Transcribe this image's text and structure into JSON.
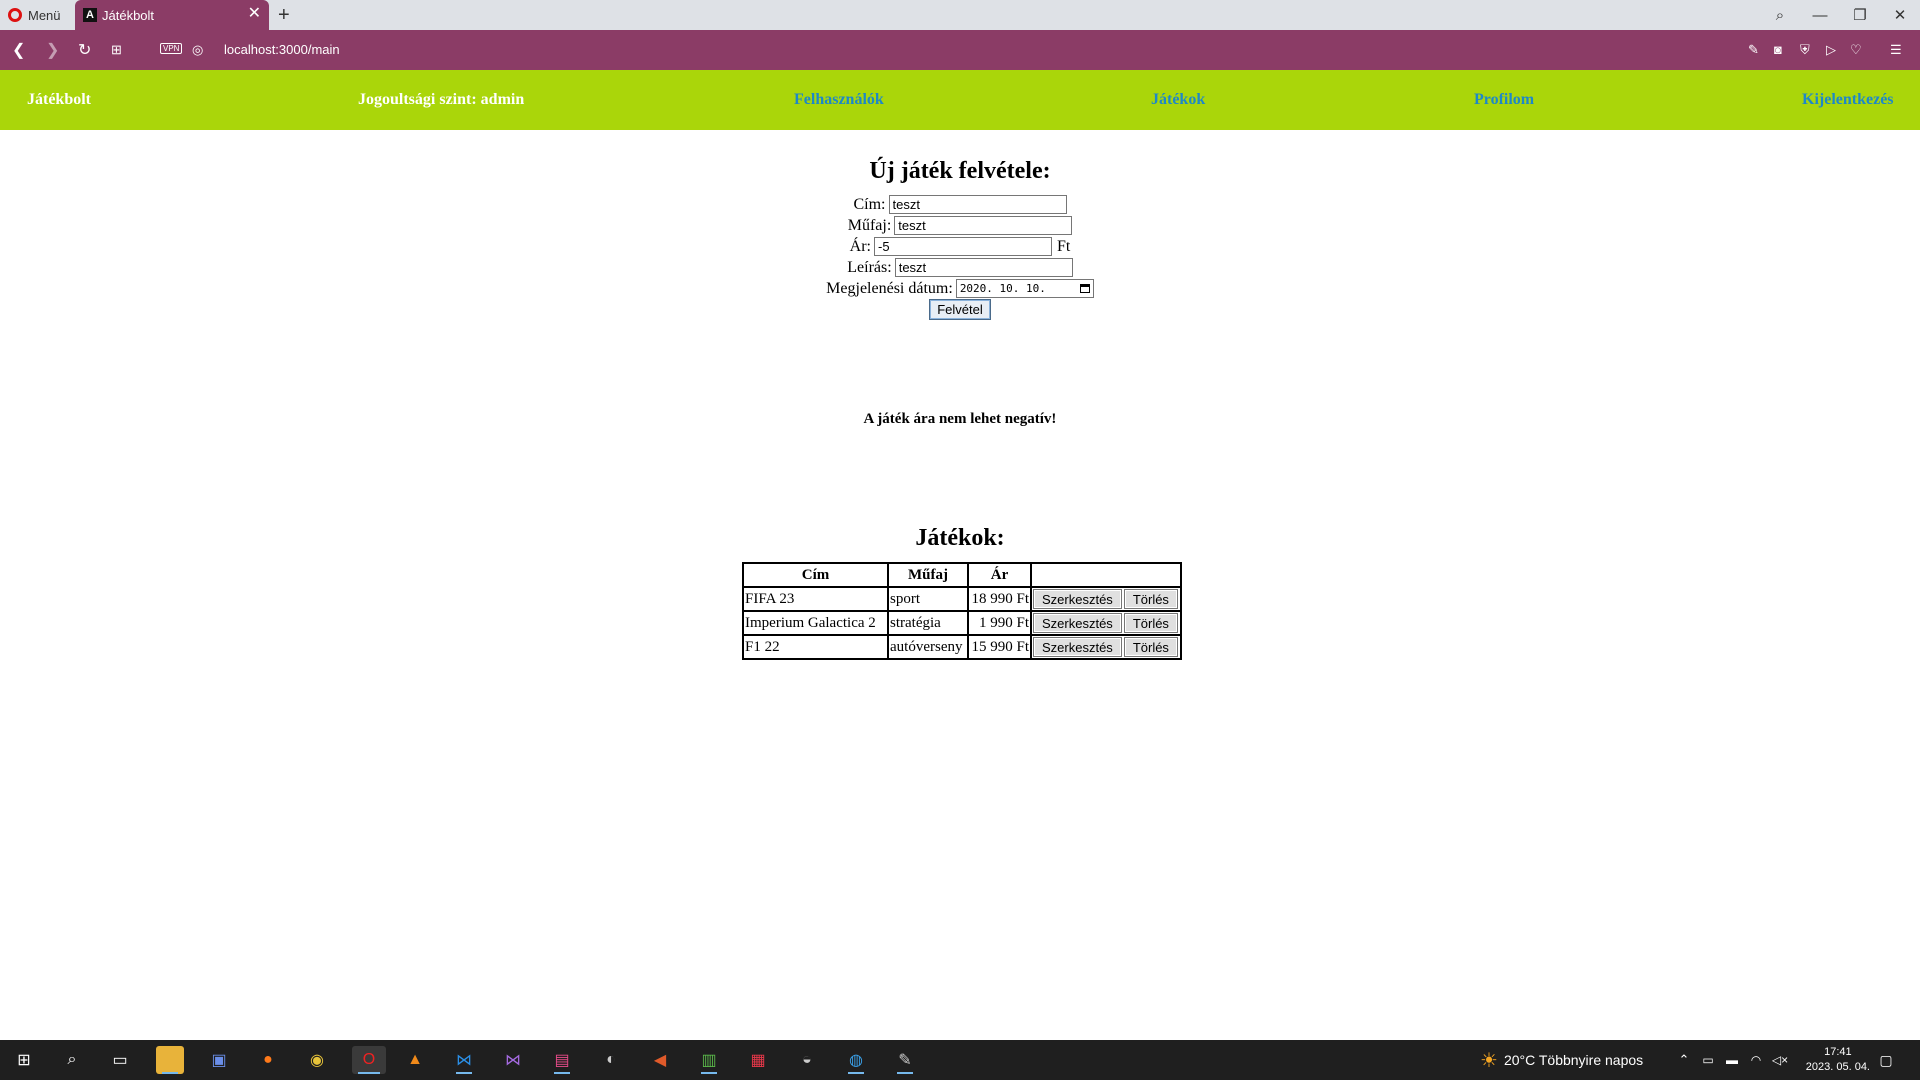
{
  "browser": {
    "menu_label": "Menü",
    "tab_title": "Játékbolt",
    "tab_favicon": "A",
    "url": "localhost:3000/main",
    "vpn_label": "VPN"
  },
  "nav": {
    "brand": "Játékbolt",
    "role": "Jogoultsági szint: admin",
    "users": "Felhasználók",
    "games": "Játékok",
    "profile": "Profilom",
    "logout": "Kijelentkezés"
  },
  "form": {
    "title": "Új játék felvétele:",
    "title_label": "Cím:",
    "title_value": "teszt",
    "genre_label": "Műfaj:",
    "genre_value": "teszt",
    "price_label": "Ár:",
    "price_value": "-5",
    "price_suffix": "Ft",
    "desc_label": "Leírás:",
    "desc_value": "teszt",
    "date_label": "Megjelenési dátum:",
    "date_value": "2020. 10. 10.",
    "submit_label": "Felvétel"
  },
  "error_message": "A játék ára nem lehet negatív!",
  "games": {
    "title": "Játékok:",
    "headers": [
      "Cím",
      "Műfaj",
      "Ár",
      ""
    ],
    "edit_label": "Szerkesztés",
    "delete_label": "Törlés",
    "rows": [
      {
        "title": "FIFA 23",
        "genre": "sport",
        "price": "18 990 Ft"
      },
      {
        "title": "Imperium Galactica 2",
        "genre": "stratégia",
        "price": "1 990 Ft"
      },
      {
        "title": "F1 22",
        "genre": "autóverseny",
        "price": "15 990 Ft"
      }
    ]
  },
  "taskbar": {
    "weather": "20°C  Többnyire napos",
    "time": "17:41",
    "date": "2023. 05. 04."
  },
  "colors": {
    "browser_accent": "#8b3c66",
    "navbar": "#aad60a",
    "nav_link": "#1e88c8"
  }
}
